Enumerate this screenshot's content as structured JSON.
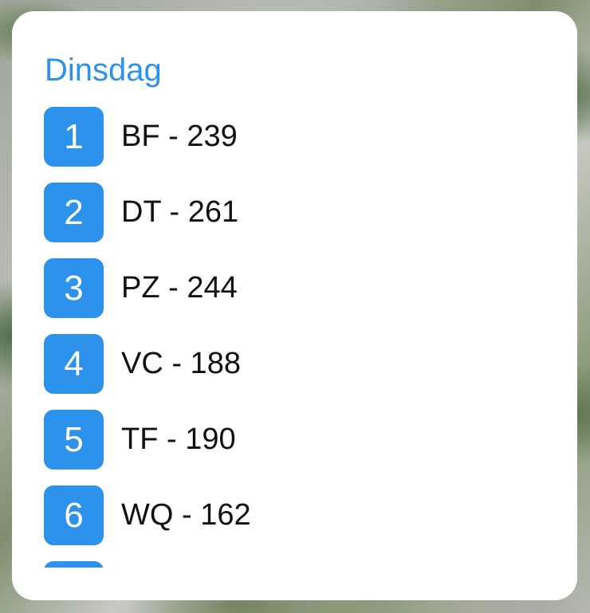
{
  "colors": {
    "accent": "#2d92eb",
    "card_background": "#ffffff",
    "text": "#111111"
  },
  "widget": {
    "title": "Dinsdag",
    "items": [
      {
        "number": "1",
        "label": "BF - 239"
      },
      {
        "number": "2",
        "label": "DT - 261"
      },
      {
        "number": "3",
        "label": "PZ - 244"
      },
      {
        "number": "4",
        "label": "VC - 188"
      },
      {
        "number": "5",
        "label": "TF - 190"
      },
      {
        "number": "6",
        "label": "WQ - 162"
      },
      {
        "number": "",
        "label": ""
      }
    ]
  }
}
